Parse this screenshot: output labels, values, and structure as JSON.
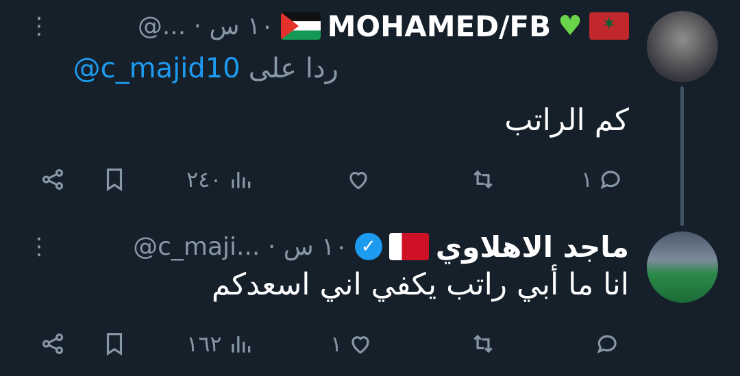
{
  "tweets": [
    {
      "display_name": "MOHAMED/FB",
      "handle": "@...",
      "separator": "·",
      "time": "١٠ س",
      "reply_label": "ردا على",
      "reply_mention": "@c_majid10",
      "text": "كم الراتب",
      "stats": {
        "replies": "١",
        "retweets": "",
        "likes": "",
        "views": "٢٤٠"
      },
      "badges": [
        "flag-morocco",
        "green-heart",
        "flag-palestine"
      ]
    },
    {
      "display_name": "ماجد الاهلاوي",
      "handle": "@c_maji...",
      "separator": "·",
      "time": "١٠ س",
      "text": "انا ما أبي راتب يكفي اني اسعدكم",
      "stats": {
        "replies": "",
        "retweets": "",
        "likes": "١",
        "views": "١٦٢"
      },
      "badges": [
        "verified-badge",
        "flag-bahrain"
      ]
    }
  ],
  "icons": [
    "more-icon",
    "reply-icon",
    "retweet-icon",
    "like-icon",
    "views-icon",
    "bookmark-icon",
    "share-icon"
  ],
  "colors": {
    "background": "#15202b",
    "secondary_text": "#8899a6",
    "accent": "#1d9bf0"
  }
}
